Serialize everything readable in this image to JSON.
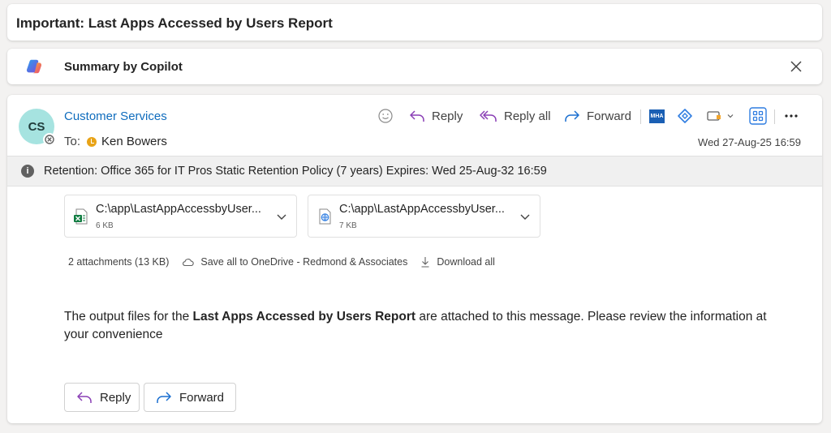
{
  "subject": "Important: Last Apps Accessed by Users Report",
  "copilot": {
    "label": "Summary by Copilot"
  },
  "message": {
    "avatar_initials": "CS",
    "sender": "Customer Services",
    "to_label": "To:",
    "recipient": "Ken Bowers",
    "date": "Wed 27-Aug-25 16:59",
    "toolbar": {
      "reply": "Reply",
      "reply_all": "Reply all",
      "forward": "Forward",
      "mha_badge": "MHA"
    },
    "retention": "Retention: Office 365 for IT Pros Static Retention Policy (7 years) Expires: Wed 25-Aug-32 16:59",
    "attachments": [
      {
        "name": "C:\\app\\LastAppAccessbyUser...",
        "size": "6 KB",
        "icon": "excel-file-icon"
      },
      {
        "name": "C:\\app\\LastAppAccessbyUser...",
        "size": "7 KB",
        "icon": "html-file-icon"
      }
    ],
    "attachment_summary": "2 attachments (13 KB)",
    "save_all": "Save all to OneDrive - Redmond & Associates",
    "download_all": "Download all",
    "body": {
      "prefix": "The output files for the ",
      "bold": "Last Apps Accessed by Users Report",
      "suffix": " are attached to this message. Please review the information at your convenience"
    },
    "buttons": {
      "reply": "Reply",
      "forward": "Forward"
    }
  },
  "colors": {
    "accent": "#0f6cbd",
    "reply_purple": "#8a3fb5",
    "forward_blue": "#1a6fd0",
    "avatar_bg": "#a6e3e0",
    "excel_green": "#107c41"
  }
}
